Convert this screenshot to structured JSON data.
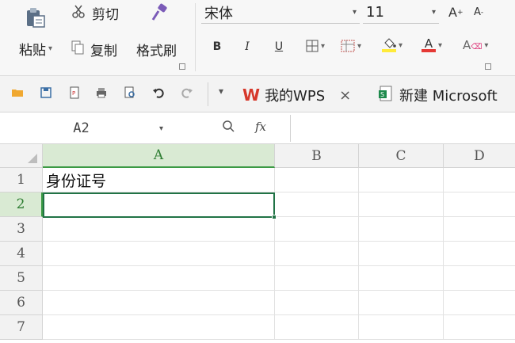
{
  "ribbon": {
    "paste_label": "粘贴",
    "cut_label": "剪切",
    "copy_label": "复制",
    "format_painter_label": "格式刷",
    "font_name": "宋体",
    "font_size": "11",
    "bold": "B",
    "italic": "I",
    "underline": "U"
  },
  "tabs": [
    {
      "label": "我的WPS",
      "close": "×"
    },
    {
      "label": "新建 Microsoft"
    }
  ],
  "formula_bar": {
    "name_box": "A2",
    "fx": "fx",
    "content": ""
  },
  "sheet": {
    "columns": [
      "A",
      "B",
      "C",
      "D"
    ],
    "rows": [
      "1",
      "2",
      "3",
      "4",
      "5",
      "6",
      "7"
    ],
    "cell_a1": "身份证号",
    "active_cell": "A2"
  },
  "colors": {
    "accent_green": "#217346",
    "wps_red": "#d6382b",
    "header_selected": "#d9ead3"
  }
}
